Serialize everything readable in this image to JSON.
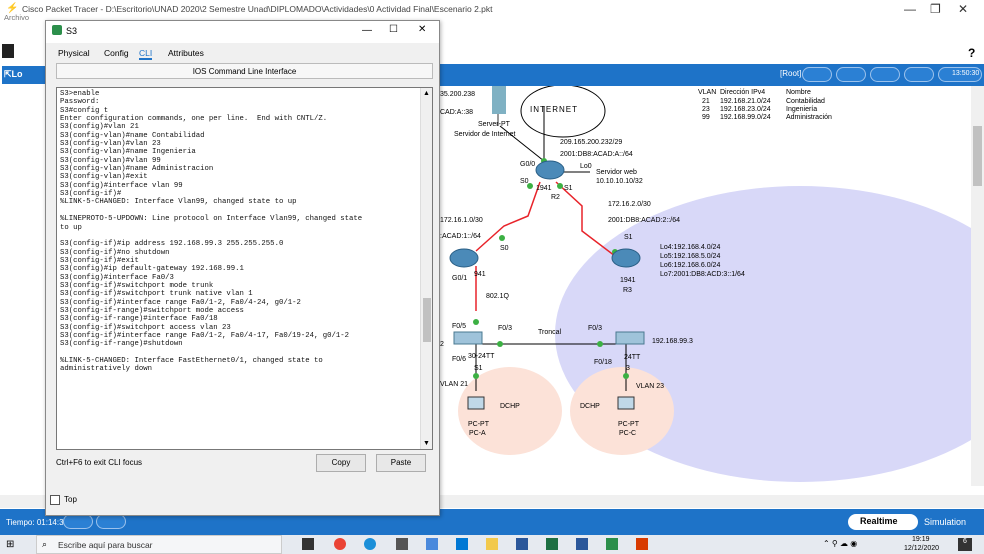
{
  "main_window": {
    "title": "Cisco Packet Tracer - D:\\Escritorio\\UNAD 2020\\2 Semestre Unad\\DIPLOMADO\\Actividades\\0 Actividad Final\\Escenario 2.pkt",
    "menu_first": "Archivo",
    "help": "?"
  },
  "toolbar": {
    "root_label": "[Root]",
    "time": "13:50:30"
  },
  "dialog": {
    "title": "S3",
    "min": "—",
    "max": "☐",
    "close": "✕",
    "tabs": [
      {
        "label": "Physical"
      },
      {
        "label": "Config"
      },
      {
        "label": "CLI"
      },
      {
        "label": "Attributes"
      }
    ],
    "cli_heading": "IOS Command Line Interface",
    "cli_text": "S3>enable\nPassword:\nS3#config t\nEnter configuration commands, one per line.  End with CNTL/Z.\nS3(config)#vlan 21\nS3(config-vlan)#name Contabilidad\nS3(config-vlan)#vlan 23\nS3(config-vlan)#name Ingenieria\nS3(config-vlan)#vlan 99\nS3(config-vlan)#name Administracion\nS3(config-vlan)#exit\nS3(config)#interface vlan 99\nS3(config-if)#\n%LINK-5-CHANGED: Interface Vlan99, changed state to up\n\n%LINEPROTO-5-UPDOWN: Line protocol on Interface Vlan99, changed state\nto up\n\nS3(config-if)#ip address 192.168.99.3 255.255.255.0\nS3(config-if)#no shutdown\nS3(config-if)#exit\nS3(config)#ip default-gateway 192.168.99.1\nS3(config)#interface Fa0/3\nS3(config-if)#switchport mode trunk\nS3(config-if)#switchport trunk native vlan 1\nS3(config-if)#interface range Fa0/1-2, Fa0/4-24, g0/1-2\nS3(config-if-range)#switchport mode access\nS3(config-if-range)#interface Fa0/18\nS3(config-if)#switchport access vlan 23\nS3(config-if)#interface range Fa0/1-2, Fa0/4-17, Fa0/19-24, g0/1-2\nS3(config-if-range)#shutdown\n\n%LINK-5-CHANGED: Interface FastEthernet0/1, changed state to\nadministratively down",
    "hint": "Ctrl+F6 to exit CLI focus",
    "copy": "Copy",
    "paste": "Paste",
    "top": "Top"
  },
  "topology": {
    "inet_left_ip": "35.200.238",
    "inet_left_v6": "CAD:A::38",
    "internet": "INTERNET",
    "server_name": "Server-PT",
    "server_label": "Servidor de Internet",
    "r2_link_ip": "209.165.200.232/29",
    "r2_link_v6": "2001:DB8:ACAD:A::/64",
    "g00": "G0/0",
    "s0_r2": "S0",
    "lo0": "Lo0",
    "r2_model": "1941",
    "r2_name": "R2",
    "s1_r2": "S1",
    "web_label": "Servidor web",
    "web_ip": "10.10.10.10/32",
    "r2r3_ip": "172.16.2.0/30",
    "r2r3_v6": "2001:DB8:ACAD:2::/64",
    "s1_r3": "S1",
    "r3_loops": [
      "Lo4:192.168.4.0/24",
      "Lo5:192.168.5.0/24",
      "Lo6:192.168.6.0/24",
      "Lo7:2001:DB8:ACD:3::1/64"
    ],
    "r3_model": "1941",
    "r3_name": "R3",
    "r1r2_ip": "172.16.1.0/30",
    "r1r2_v6": ":ACAD:1::/64",
    "s0_r1": "S0",
    "g01": "G0/1",
    "r1_model": "941",
    "dot1q": "802.1Q",
    "f05": "F0/5",
    "f03a": "F0/3",
    "troncal": "Troncal",
    "f03b": "F0/3",
    "s3_ip": "192.168.99.3",
    "f06": "F0/6",
    "s1_model": "30-24TT",
    "s1_name": "S1",
    "f018": "F0/18",
    "s3_model": "24TT",
    "s3_name": "3",
    "vlan21": "VLAN 21",
    "vlan23": "VLAN 23",
    "dchp1": "DCHP",
    "dchp2": "DCHP",
    "pca_type": "PC-PT",
    "pca_name": "PC-A",
    "pcc_type": "PC-PT",
    "pcc_name": "PC-C",
    "edge2": "2",
    "vlan_table": {
      "headers": [
        "VLAN",
        "Dirección IPv4",
        "Nombre"
      ],
      "rows": [
        [
          "21",
          "192.168.21.0/24",
          "Contabilidad"
        ],
        [
          "23",
          "192.168.23.0/24",
          "Ingeniería"
        ],
        [
          "99",
          "192.168.99.0/24",
          "Administración"
        ]
      ]
    }
  },
  "status": {
    "time": "Tiempo: 01:14:38",
    "realtime": "Realtime",
    "simulation": "Simulation"
  },
  "taskbar": {
    "search": "Escribe aquí para buscar",
    "clock": "19:19",
    "date": "12/12/2020",
    "notif": "6"
  },
  "colors": {
    "accent": "#1e73c8",
    "link_red": "#e8232a",
    "link_green": "#3cb043",
    "lan_bg": "#d8d8f8"
  }
}
